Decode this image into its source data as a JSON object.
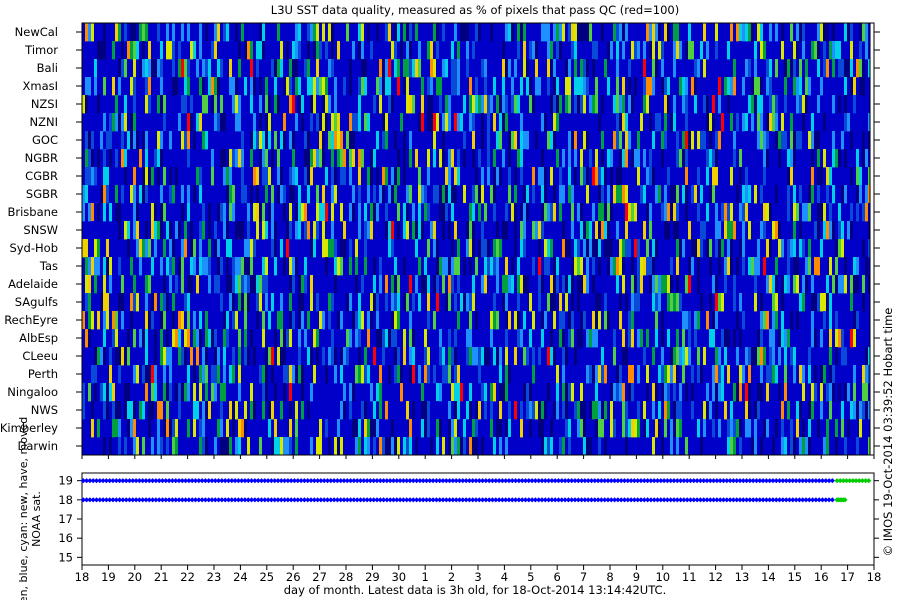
{
  "chart_data": [
    {
      "type": "heatmap",
      "title": "L3U SST data quality, measured as % of pixels that pass QC (red=100)",
      "rows": [
        "NewCal",
        "Timor",
        "Bali",
        "XmasI",
        "NZSI",
        "NZNI",
        "GOC",
        "NGBR",
        "CGBR",
        "SGBR",
        "Brisbane",
        "SNSW",
        "Syd-Hob",
        "Tas",
        "Adelaide",
        "SAgulfs",
        "RechEyre",
        "AlbEsp",
        "CLeeu",
        "Perth",
        "Ningaloo",
        "NWS",
        "Kimberley",
        "Darwin"
      ],
      "value_unit": "% of pixels that pass QC",
      "colormap": [
        "#000080",
        "#0000c8",
        "#0a4ad8",
        "#1e90ff",
        "#00d0e8",
        "#00a040",
        "#50d040",
        "#d8e800",
        "#f0d000",
        "#ff8c00"
      ],
      "colormap_max_color": "#ff0000"
    },
    {
      "type": "scatter",
      "ylabel": "green, blue, cyan: new, have, moved NOAA sat.",
      "yticks": [
        15,
        16,
        17,
        18,
        19
      ],
      "ylim": [
        14.6,
        19.4
      ],
      "series": [
        {
          "color": "#0000ff",
          "values": [
            [
              18.0,
              19
            ],
            [
              16.45,
              19
            ],
            [
              18.0,
              18
            ],
            [
              16.45,
              18
            ]
          ]
        },
        {
          "color": "#00cc00",
          "values": [
            [
              16.6,
              19
            ],
            [
              17.4,
              19
            ],
            [
              16.6,
              18
            ],
            [
              16.95,
              18
            ]
          ]
        }
      ]
    }
  ],
  "x_axis": {
    "ticks": [
      "18",
      "19",
      "20",
      "21",
      "22",
      "23",
      "24",
      "25",
      "26",
      "27",
      "28",
      "29",
      "30",
      "1",
      "2",
      "3",
      "4",
      "5",
      "6",
      "7",
      "8",
      "9",
      "10",
      "11",
      "12",
      "13",
      "14",
      "15",
      "16",
      "17",
      "18"
    ],
    "label": "day of month. Latest data is 3h old, for 18-Oct-2014 13:14:42UTC."
  },
  "side_label": "© IMOS 19-Oct-2014 03:39:52 Hobart time",
  "colors": {
    "frame": "#000000",
    "background": "#ffffff",
    "grid": "#000000"
  }
}
